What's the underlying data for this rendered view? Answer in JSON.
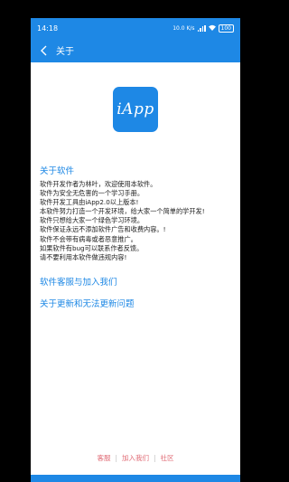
{
  "status": {
    "time": "14:18",
    "net": "10.0 K/s",
    "battery": "100"
  },
  "header": {
    "title": "关于"
  },
  "logo": {
    "text": "iApp"
  },
  "about": {
    "title": "关于软件",
    "lines": [
      "软件开发作者为林叶，欢迎使用本软件。",
      "软件为安全无危害的一个学习手册。",
      "软件开发工具由iApp2.0以上版本!",
      "本软件努力打造一个开发环境，给大家一个简单的学开发!",
      "软件只想给大家一个绿色学习环境。",
      "软件保证永远不添加软件广告和收费内容。!",
      "软件不会带有病毒或者恶意推广。",
      "如果软件有bug可以联系作者反馈。",
      "请不要利用本软件做违规内容!"
    ]
  },
  "links": {
    "service": "软件客服与加入我们",
    "updates": "关于更新和无法更新问题"
  },
  "footer": {
    "service": "客服",
    "join": "加入我们",
    "community": "社区",
    "separator": "|"
  },
  "colors": {
    "primary": "#1e88e5",
    "footer_link": "#e06b75"
  }
}
